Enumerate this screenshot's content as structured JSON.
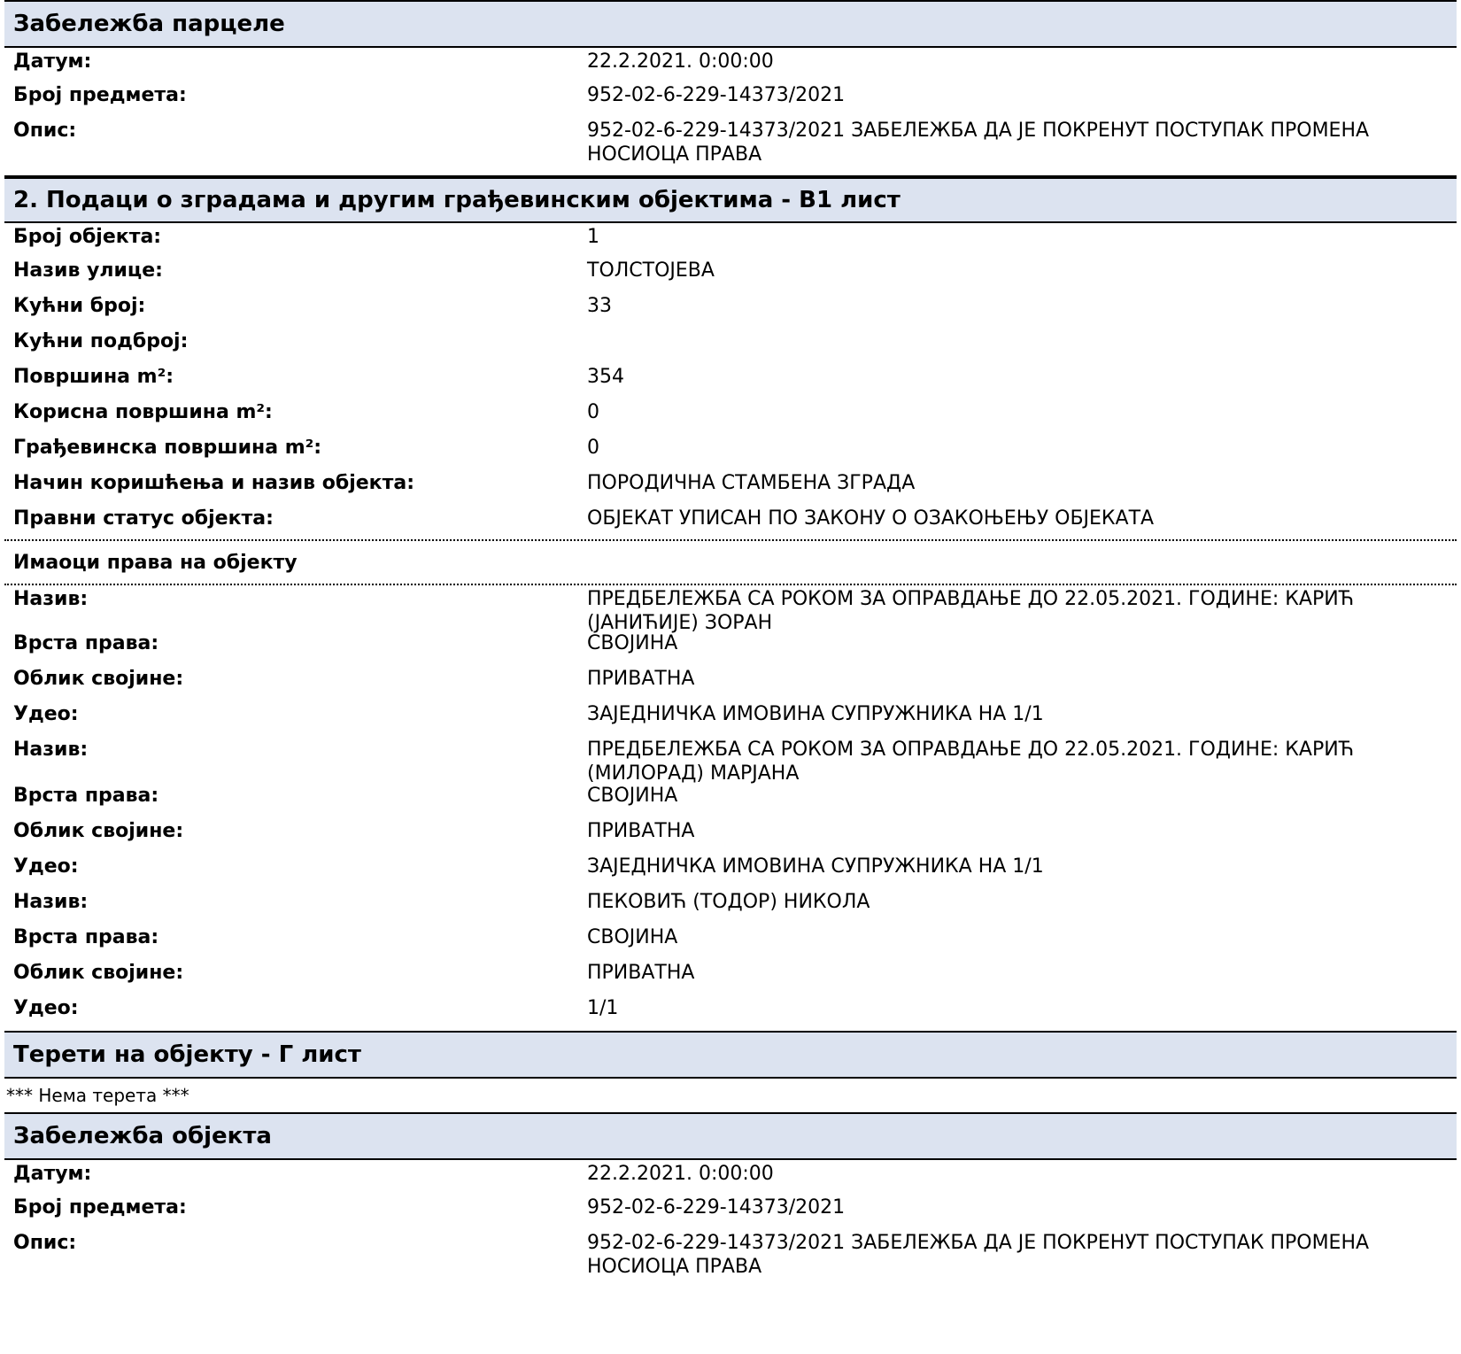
{
  "parcel_note": {
    "title": "Забележба парцеле",
    "rows": [
      {
        "label": "Датум:",
        "value": "22.2.2021. 0:00:00"
      },
      {
        "label": "Број предмета:",
        "value": "952-02-6-229-14373/2021"
      },
      {
        "label": "Опис:",
        "value": "952-02-6-229-14373/2021 ЗАБЕЛЕЖБА ДА ЈЕ ПОКРЕНУТ ПОСТУПАК ПРОМЕНА",
        "value2": "НОСИОЦА ПРАВА"
      }
    ]
  },
  "buildings": {
    "title": "2. Подаци о зградама и другим грађевинским објектима - В1 лист",
    "rows": [
      {
        "label": "Број објекта:",
        "value": "1"
      },
      {
        "label": "Назив улице:",
        "value": "ТОЛСТОЈЕВА"
      },
      {
        "label": "Кућни број:",
        "value": "33"
      },
      {
        "label": "Кућни подброј:",
        "value": ""
      },
      {
        "label": "Површина m²:",
        "value": "354"
      },
      {
        "label": "Корисна површина m²:",
        "value": "0"
      },
      {
        "label": "Грађевинска површина m²:",
        "value": "0"
      },
      {
        "label": "Начин коришћења и назив објекта:",
        "value": "ПОРОДИЧНА СТАМБЕНА ЗГРАДА"
      },
      {
        "label": "Правни статус објекта:",
        "value": "ОБЈЕКАТ УПИСАН ПО ЗАКОНУ О ОЗАКОЊЕЊУ ОБЈЕКАТА"
      }
    ]
  },
  "owners": {
    "title": "Имаоци права на објекту",
    "rows": [
      {
        "label": "Назив:",
        "value": "ПРЕДБЕЛЕЖБА СА РОКОМ ЗА ОПРАВДАЊЕ ДО 22.05.2021. ГОДИНЕ: КАРИЋ",
        "value2": "(ЈАНИЋИЈЕ) ЗОРАН"
      },
      {
        "label": "Врста права:",
        "value": "СВОЈИНА"
      },
      {
        "label": "Облик својине:",
        "value": "ПРИВАТНА"
      },
      {
        "label": "Удео:",
        "value": "ЗАЈЕДНИЧКА ИМОВИНА СУПРУЖНИКА НА 1/1"
      },
      {
        "label": "Назив:",
        "value": "ПРЕДБЕЛЕЖБА СА РОКОМ ЗА ОПРАВДАЊЕ ДО 22.05.2021. ГОДИНЕ: КАРИЋ",
        "value2": "(МИЛОРАД) МАРЈАНА"
      },
      {
        "label": "Врста права:",
        "value": "СВОЈИНА"
      },
      {
        "label": "Облик својине:",
        "value": "ПРИВАТНА"
      },
      {
        "label": "Удео:",
        "value": "ЗАЈЕДНИЧКА ИМОВИНА СУПРУЖНИКА НА 1/1"
      },
      {
        "label": "Назив:",
        "value": "ПЕКОВИЋ (ТОДОР) НИКОЛА"
      },
      {
        "label": "Врста права:",
        "value": "СВОЈИНА"
      },
      {
        "label": "Облик својине:",
        "value": "ПРИВАТНА"
      },
      {
        "label": "Удео:",
        "value": "1/1"
      }
    ]
  },
  "burdens": {
    "title": "Терети на објекту - Г лист",
    "note": "*** Нема терета ***"
  },
  "object_note": {
    "title": "Забележба објекта",
    "rows": [
      {
        "label": "Датум:",
        "value": "22.2.2021. 0:00:00"
      },
      {
        "label": "Број предмета:",
        "value": "952-02-6-229-14373/2021"
      },
      {
        "label": "Опис:",
        "value": "952-02-6-229-14373/2021 ЗАБЕЛЕЖБА ДА ЈЕ ПОКРЕНУТ ПОСТУПАК ПРОМЕНА",
        "value2": "НОСИОЦА ПРАВА"
      }
    ]
  }
}
